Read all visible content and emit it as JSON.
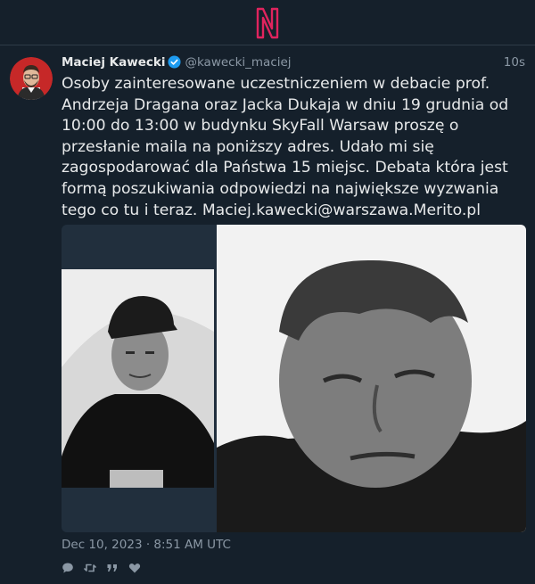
{
  "app": {
    "logo_icon": "n-logo-icon",
    "accent_color": "#e0245e",
    "background_color": "#15202b"
  },
  "tweet": {
    "author_name": "Maciej Kawecki",
    "verified_icon": "verified-badge-icon",
    "handle": "@kawecki_maciej",
    "relative_time": "10s",
    "text": "Osoby zainteresowane uczestniczeniem w debacie prof. Andrzeja Dragana oraz Jacka Dukaja w dniu 19 grudnia od 10:00 do 13:00 w budynku SkyFall Warsaw proszę o przesłanie maila na poniższy adres. Udało mi się zagospodarować dla Państwa 15 miejsc. Debata która jest formą poszukiwania odpowiedzi na największe wyzwania tego co tu i teraz. Maciej.kawecki@warszawa.Merito.pl",
    "timestamp": "Dec 10, 2023 · 8:51 AM UTC"
  },
  "media": {
    "left_photo": "black-and-white portrait of man in cap",
    "right_photo": "black-and-white portrait of man with grey hair"
  },
  "actions": [
    {
      "icon": "reply-icon"
    },
    {
      "icon": "retweet-icon"
    },
    {
      "icon": "quote-icon"
    },
    {
      "icon": "like-icon"
    }
  ]
}
